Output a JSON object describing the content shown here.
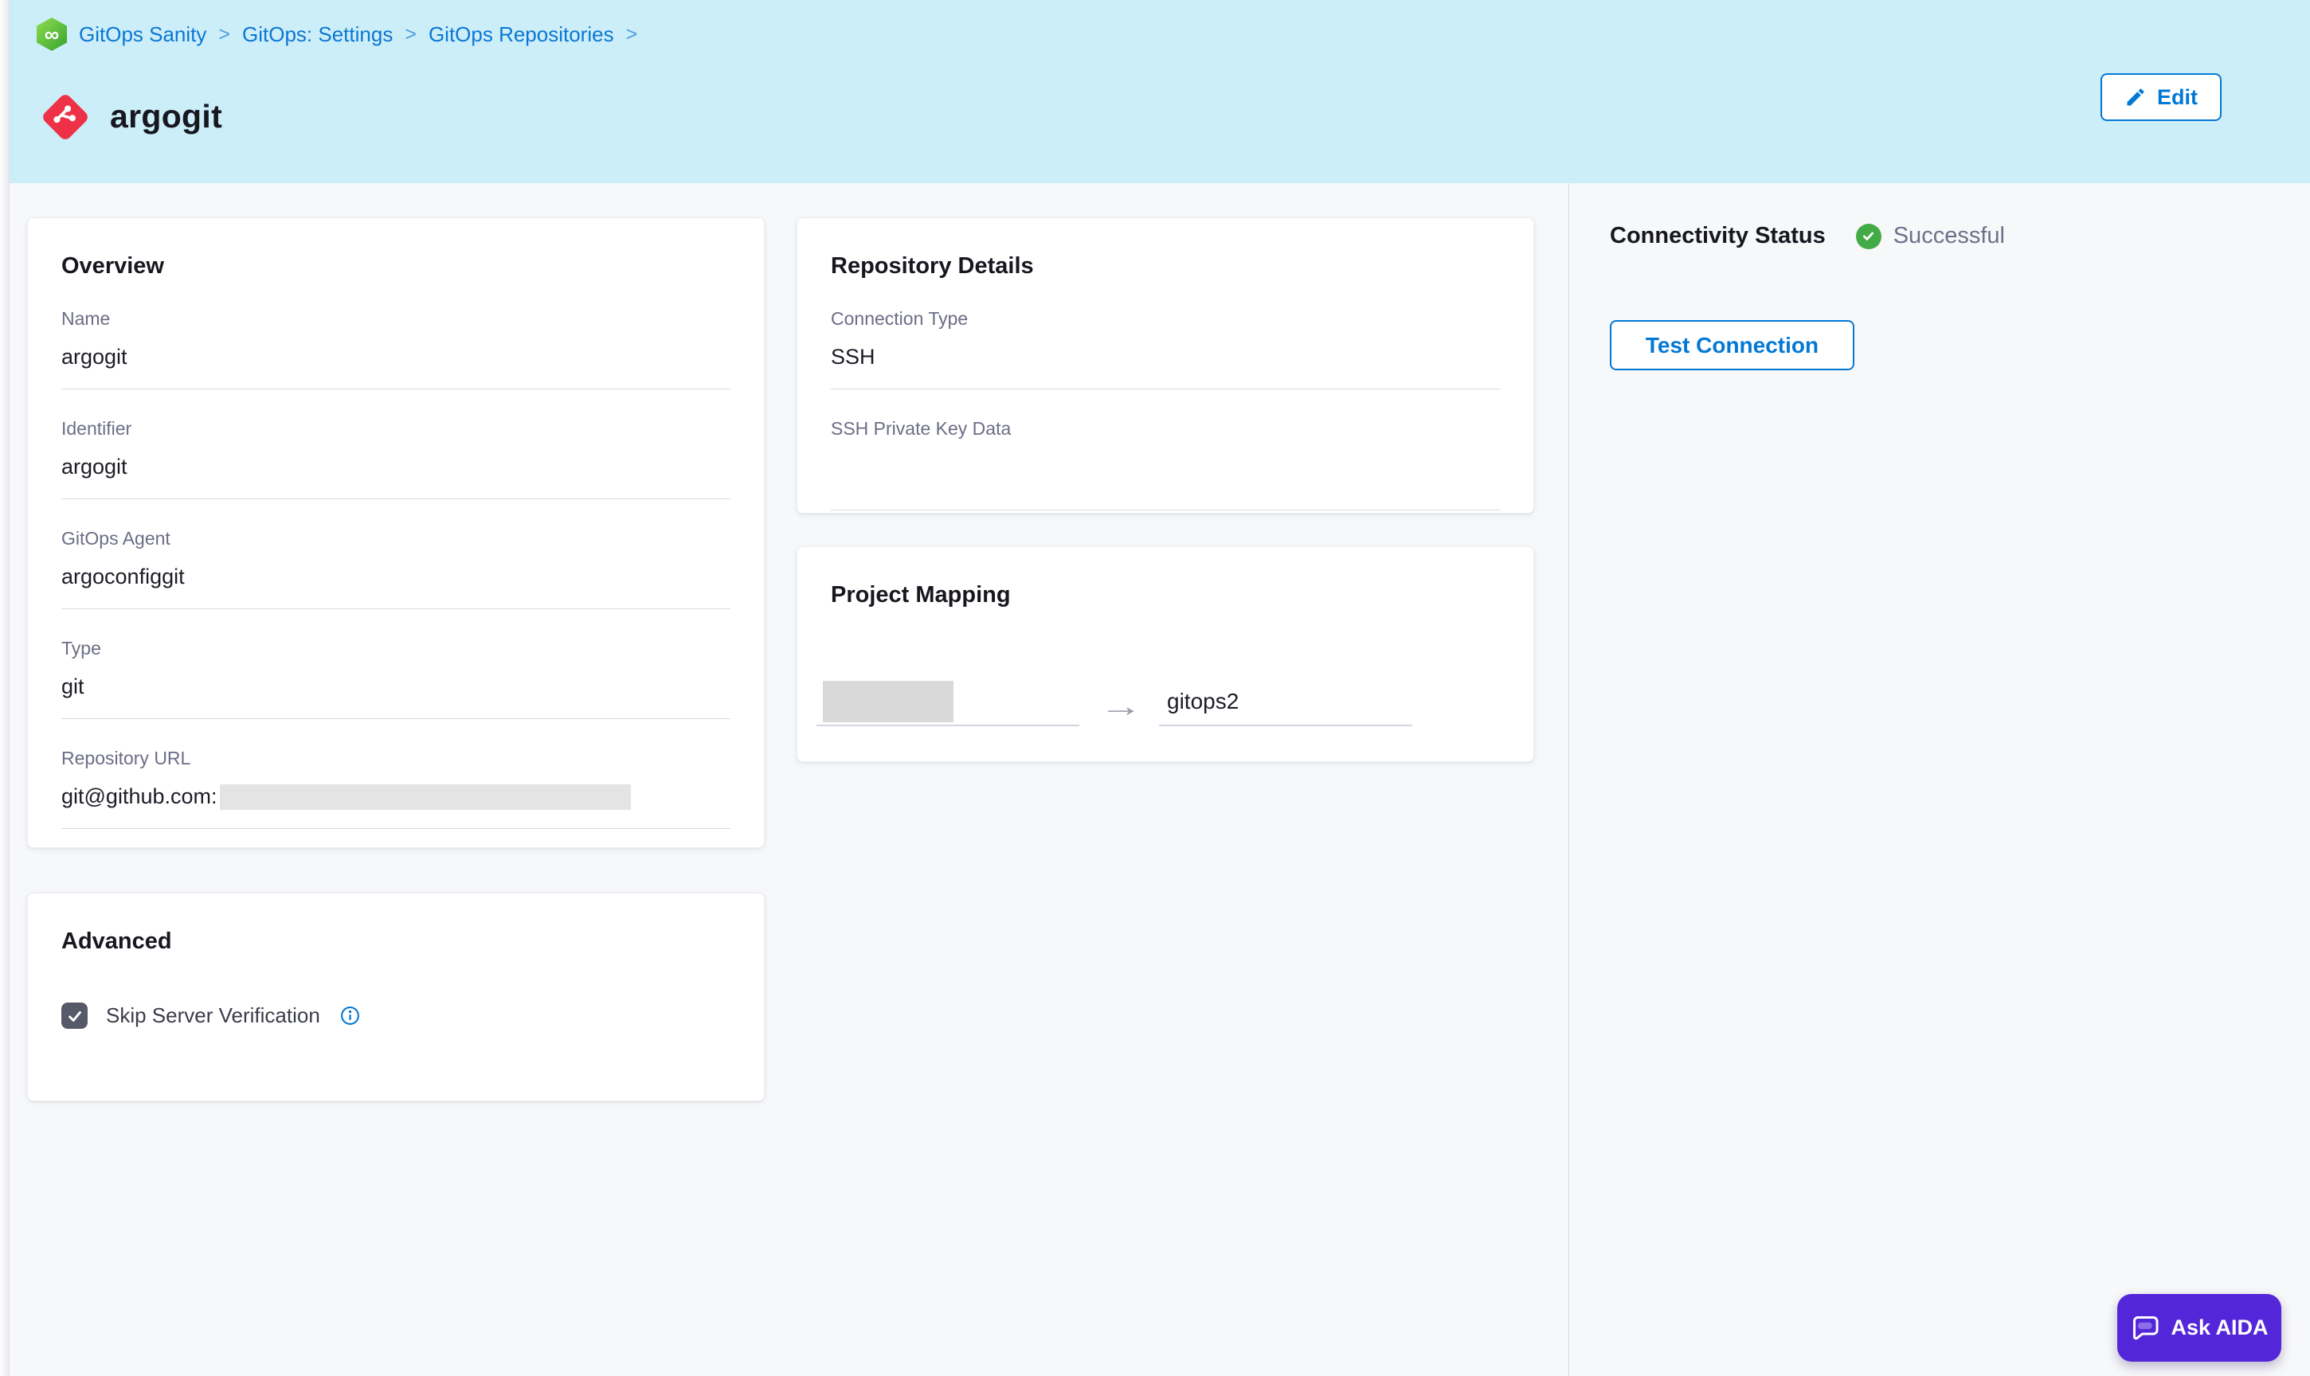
{
  "breadcrumb": {
    "items": [
      "GitOps Sanity",
      "GitOps: Settings",
      "GitOps Repositories"
    ],
    "separator": ">",
    "module_icon_glyph": "∞"
  },
  "header": {
    "title": "argogit",
    "edit_button": "Edit"
  },
  "overview": {
    "title": "Overview",
    "fields": [
      {
        "label": "Name",
        "value": "argogit"
      },
      {
        "label": "Identifier",
        "value": "argogit"
      },
      {
        "label": "GitOps Agent",
        "value": "argoconfiggit"
      },
      {
        "label": "Type",
        "value": "git"
      },
      {
        "label": "Repository URL",
        "value": "git@github.com:",
        "value_redacted": true
      }
    ]
  },
  "advanced": {
    "title": "Advanced",
    "checkbox_label": "Skip Server Verification",
    "checkbox_checked": true
  },
  "repository_details": {
    "title": "Repository Details",
    "fields": [
      {
        "label": "Connection Type",
        "value": "SSH"
      },
      {
        "label": "SSH Private Key Data",
        "value": ""
      }
    ]
  },
  "project_mapping": {
    "title": "Project Mapping",
    "source_redacted": true,
    "arrow": "→",
    "target": "gitops2"
  },
  "connectivity": {
    "title": "Connectivity Status",
    "status": "Successful",
    "test_button": "Test Connection"
  },
  "aida": {
    "button": "Ask AIDA"
  },
  "colors": {
    "header_background": "#cceef9",
    "page_background": "#f7f8fa",
    "primary_blue": "#0278d5",
    "success_green": "#42ab45",
    "aida_purple": "#5326d9",
    "git_icon_red": "#ee3146",
    "gitops_icon_green": "#37a22e",
    "label_gray": "#6b6d85",
    "divider": "#d9dae5"
  }
}
